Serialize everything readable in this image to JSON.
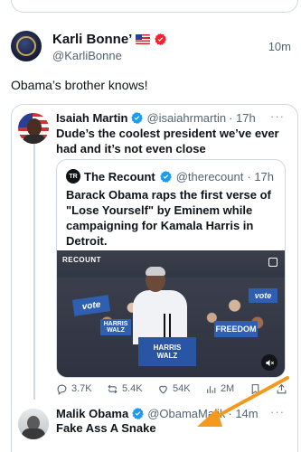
{
  "post": {
    "display_name": "Karli Bonne’",
    "handle": "@KarliBonne",
    "time": "10m",
    "text": "Obama’s brother knows!"
  },
  "quote": {
    "name": "Isaiah Martin",
    "handle": "@isaiahrmartin",
    "time": "· 17h",
    "more": "···",
    "text": "Dude’s the coolest president we’ve ever had and it’s not even close"
  },
  "inner_quote": {
    "logo": "TR",
    "name": "The Recount",
    "handle": "@therecount",
    "time": "· 17h",
    "text": "Barack Obama raps the first verse of \"Lose Yourself\" by Eminem while campaigning for Kamala Harris in Detroit.",
    "video": {
      "watermark": "RECOUNT",
      "sign_vote": "vote",
      "sign_harris_line1": "HARRIS",
      "sign_harris_line2": "WALZ",
      "sign_freedom": "FREEDOM",
      "sign_vote2": "vote",
      "podium_line1": "HARRIS",
      "podium_line2": "WALZ",
      "mute_icon": "speaker-muted-icon"
    }
  },
  "actions": {
    "replies": "3.7K",
    "reposts": "5.4K",
    "likes": "54K",
    "views": "2M"
  },
  "reply": {
    "name": "Malik Obama",
    "handle": "@ObamaMalik",
    "time": "· 14m",
    "more": "···",
    "text": "Fake Ass A Snake"
  },
  "colors": {
    "verified_blue": "#1d9bf0",
    "verified_red": "#f4212e",
    "annotation_arrow": "#f39a1e",
    "muted_text": "#536471"
  }
}
